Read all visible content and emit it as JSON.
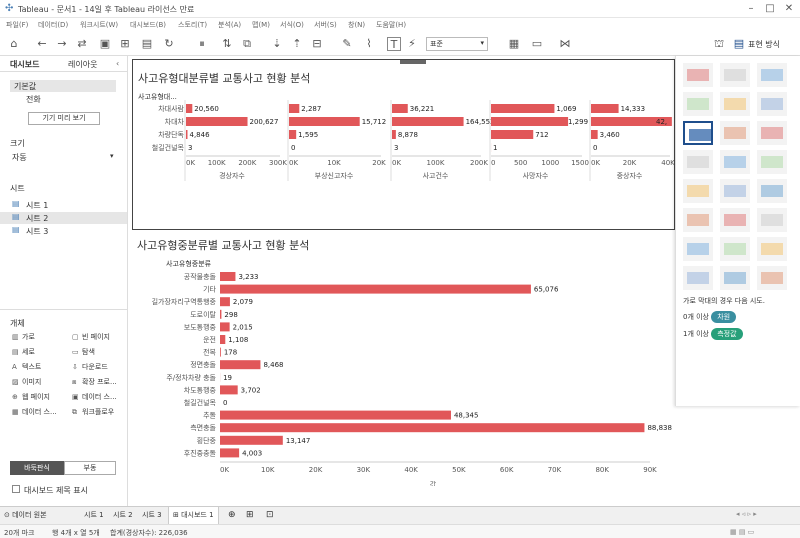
{
  "window": {
    "title": "Tableau - 문서1 - 14일 후 Tableau 라이선스 만료"
  },
  "menu": [
    "파일(F)",
    "데이터(D)",
    "워크시트(W)",
    "대시보드(B)",
    "스토리(T)",
    "분석(A)",
    "맵(M)",
    "서식(O)",
    "서버(S)",
    "창(N)",
    "도움말(H)"
  ],
  "toolbar": {
    "font_select": "표준",
    "show_me_label": "표현 방식"
  },
  "sidebar": {
    "tab_dashboard": "대시보드",
    "tab_layout": "레이아웃",
    "device_default": "기본값",
    "device_phone": "전화",
    "preview_button": "기기 미리 보기",
    "size_title": "크기",
    "size_value": "자동",
    "sheets_title": "시트",
    "sheets": [
      "시트 1",
      "시트 2",
      "시트 3"
    ],
    "objects_title": "개체",
    "objects": [
      {
        "icon": "horizontal-icon",
        "label": "가로"
      },
      {
        "icon": "blank-icon",
        "label": "빈 페이지"
      },
      {
        "icon": "vertical-icon",
        "label": "세로"
      },
      {
        "icon": "nav-icon",
        "label": "탐색"
      },
      {
        "icon": "text-icon",
        "label": "텍스트"
      },
      {
        "icon": "download-icon",
        "label": "다운로드"
      },
      {
        "icon": "image-icon",
        "label": "이미지"
      },
      {
        "icon": "extension-icon",
        "label": "확장 프로..."
      },
      {
        "icon": "web-icon",
        "label": "웹 페이지"
      },
      {
        "icon": "data-story-icon",
        "label": "데이터 스..."
      },
      {
        "icon": "ask-data-icon",
        "label": "데이터 스..."
      },
      {
        "icon": "workflow-icon",
        "label": "워크플로우"
      }
    ],
    "float_toggle": [
      "바둑판식",
      "부동"
    ],
    "show_title_label": "대시보드 제목 표시"
  },
  "sheet1": {
    "title": "사고유형대분류별 교통사고 현황 분석",
    "row_header": "사고유형대...",
    "rows": [
      "차대사람",
      "차대차",
      "차량단독",
      "철길건널목"
    ],
    "measures": [
      {
        "name": "경상자수",
        "values": [
          20560,
          200627,
          4846,
          3
        ],
        "labels": [
          "20,560",
          "200,627",
          "4,846",
          "3"
        ],
        "ticks": [
          "0K",
          "100K",
          "200K",
          "300K"
        ],
        "max": 300000
      },
      {
        "name": "부상신고자수",
        "values": [
          2287,
          15712,
          1595,
          0
        ],
        "labels": [
          "2,287",
          "15,712",
          "1,595",
          "0"
        ],
        "ticks": [
          "0K",
          "10K",
          "20K"
        ],
        "max": 20000
      },
      {
        "name": "사고건수",
        "values": [
          36221,
          164552,
          8878,
          3
        ],
        "labels": [
          "36,221",
          "164,552",
          "8,878",
          "3"
        ],
        "ticks": [
          "0K",
          "100K",
          "200K"
        ],
        "max": 200000
      },
      {
        "name": "사망자수",
        "values": [
          1069,
          1299,
          712,
          1
        ],
        "labels": [
          "1,069",
          "1,299",
          "712",
          "1"
        ],
        "ticks": [
          "0",
          "500",
          "1000",
          "1500"
        ],
        "max": 1500
      },
      {
        "name": "중상자수",
        "values": [
          14333,
          42000,
          3460,
          0
        ],
        "labels": [
          "14,333",
          "42,",
          "3,460",
          "0"
        ],
        "ticks": [
          "0K",
          "20K",
          "40K"
        ],
        "max": 40000
      }
    ]
  },
  "sheet2": {
    "title": "사고유형중분류별 교통사고 현황 분석",
    "row_header": "사고유형중분류",
    "x_title": "값",
    "ticks": [
      "0K",
      "10K",
      "20K",
      "30K",
      "40K",
      "50K",
      "60K",
      "70K",
      "80K",
      "90K"
    ],
    "max": 90000,
    "rows": [
      {
        "name": "공작물충돌",
        "value": 3233,
        "label": "3,233"
      },
      {
        "name": "기타",
        "value": 65076,
        "label": "65,076"
      },
      {
        "name": "길가장자리구역통행중",
        "value": 2079,
        "label": "2,079"
      },
      {
        "name": "도로이탈",
        "value": 298,
        "label": "298"
      },
      {
        "name": "보도통행중",
        "value": 2015,
        "label": "2,015"
      },
      {
        "name": "운전",
        "value": 1108,
        "label": "1,108"
      },
      {
        "name": "전복",
        "value": 178,
        "label": "178"
      },
      {
        "name": "정면충돌",
        "value": 8468,
        "label": "8,468"
      },
      {
        "name": "주/정차차량 충돌",
        "value": 19,
        "label": "19"
      },
      {
        "name": "차도통행중",
        "value": 3702,
        "label": "3,702"
      },
      {
        "name": "철길건널목",
        "value": 0,
        "label": "0"
      },
      {
        "name": "추돌",
        "value": 48345,
        "label": "48,345"
      },
      {
        "name": "측면충돌",
        "value": 88838,
        "label": "88,838"
      },
      {
        "name": "횡단중",
        "value": 13147,
        "label": "13,147"
      },
      {
        "name": "후진중충돌",
        "value": 4003,
        "label": "4,003"
      }
    ]
  },
  "chart_data": [
    {
      "type": "bar",
      "title": "사고유형대분류별 교통사고 현황 분석",
      "categories": [
        "차대사람",
        "차대차",
        "차량단독",
        "철길건널목"
      ],
      "series": [
        {
          "name": "경상자수",
          "values": [
            20560,
            200627,
            4846,
            3
          ]
        },
        {
          "name": "부상신고자수",
          "values": [
            2287,
            15712,
            1595,
            0
          ]
        },
        {
          "name": "사고건수",
          "values": [
            36221,
            164552,
            8878,
            3
          ]
        },
        {
          "name": "사망자수",
          "values": [
            1069,
            1299,
            712,
            1
          ]
        },
        {
          "name": "중상자수",
          "values": [
            14333,
            42000,
            3460,
            0
          ]
        }
      ]
    },
    {
      "type": "bar",
      "title": "사고유형중분류별 교통사고 현황 분석",
      "xlabel": "값",
      "categories": [
        "공작물충돌",
        "기타",
        "길가장자리구역통행중",
        "도로이탈",
        "보도통행중",
        "운전",
        "전복",
        "정면충돌",
        "주/정차차량 충돌",
        "차도통행중",
        "철길건널목",
        "추돌",
        "측면충돌",
        "횡단중",
        "후진중충돌"
      ],
      "values": [
        3233,
        65076,
        2079,
        298,
        2015,
        1108,
        178,
        8468,
        19,
        3702,
        0,
        48345,
        88838,
        13147,
        4003
      ],
      "xlim": [
        0,
        90000
      ]
    }
  ],
  "showme": {
    "hint": "가로 막대의 경우 다음 시도.",
    "line1_prefix": "0개 이상",
    "line1_pill": "차원",
    "line2_prefix": "1개 이상",
    "line2_pill": "측정값",
    "colors": {
      "teal": "#3a8fa0",
      "green": "#27a07a"
    }
  },
  "sheet_tabs": [
    "데이터 원본",
    "시트 1",
    "시트 2",
    "시트 3",
    "대시보드 1"
  ],
  "status": {
    "marks": "20개 마크",
    "rows": "행 4개 x 열 5개",
    "sum": "합계(경상자수): 226,036"
  },
  "colors": {
    "bar": "#e15759",
    "accent": "#1f77b4"
  }
}
